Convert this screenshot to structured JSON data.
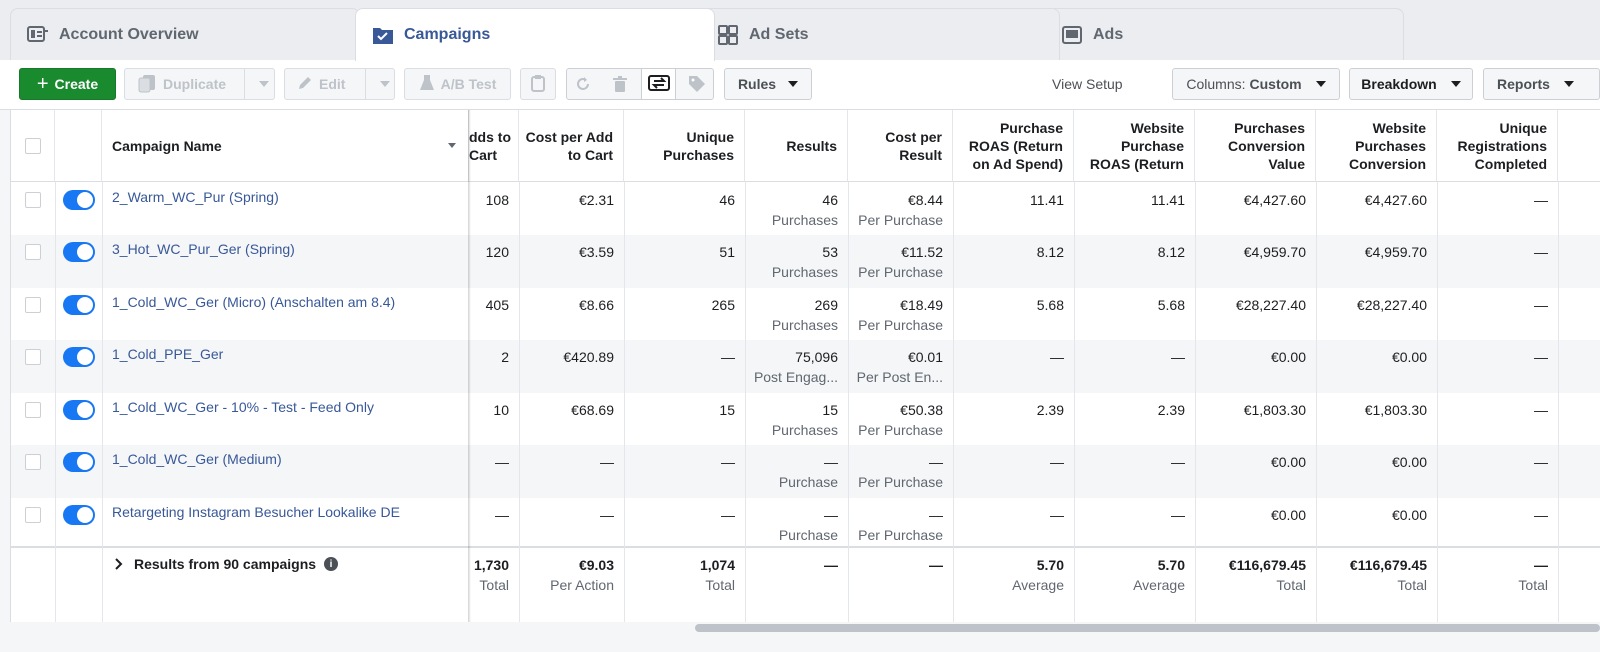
{
  "tabs": [
    {
      "label": "Account Overview",
      "icon": "account-overview-icon"
    },
    {
      "label": "Campaigns",
      "icon": "campaigns-folder-icon"
    },
    {
      "label": "Ad Sets",
      "icon": "ad-sets-grid-icon"
    },
    {
      "label": "Ads",
      "icon": "ads-icon"
    }
  ],
  "toolbar": {
    "create": "Create",
    "duplicate": "Duplicate",
    "edit": "Edit",
    "ab_test": "A/B Test",
    "rules": "Rules",
    "view_setup": "View Setup",
    "columns_prefix": "Columns:",
    "columns_value": "Custom",
    "breakdown": "Breakdown",
    "reports": "Reports"
  },
  "colors": {
    "accent": "#1877f2",
    "create_green": "#1a8a2e",
    "link": "#385898"
  },
  "table": {
    "headers": {
      "campaign_name": "Campaign Name",
      "adds_to_cart": "dds to Cart",
      "cost_per_add": "Cost per Add to Cart",
      "unique_purchases": "Unique Purchases",
      "results": "Results",
      "cost_per_result": "Cost per Result",
      "purchase_roas": "Purchase ROAS (Return on Ad Spend)",
      "website_roas": "Website Purchase ROAS (Return",
      "conv_value": "Purchases Conversion Value",
      "website_conv": "Website Purchases Conversion",
      "unique_reg": "Unique Registrations Completed"
    },
    "rows": [
      {
        "name": "2_Warm_WC_Pur (Spring)",
        "adds": "108",
        "cpa": "€2.31",
        "uniq": "46",
        "res": "46",
        "res_sub": "Purchases",
        "cpr": "€8.44",
        "cpr_sub": "Per Purchase",
        "roas": "11.41",
        "wroas": "11.41",
        "cv": "€4,427.60",
        "wcv": "€4,427.60",
        "ureg": "—"
      },
      {
        "name": "3_Hot_WC_Pur_Ger (Spring)",
        "adds": "120",
        "cpa": "€3.59",
        "uniq": "51",
        "res": "53",
        "res_sub": "Purchases",
        "cpr": "€11.52",
        "cpr_sub": "Per Purchase",
        "roas": "8.12",
        "wroas": "8.12",
        "cv": "€4,959.70",
        "wcv": "€4,959.70",
        "ureg": "—"
      },
      {
        "name": "1_Cold_WC_Ger (Micro) (Anschalten am 8.4)",
        "adds": "405",
        "cpa": "€8.66",
        "uniq": "265",
        "res": "269",
        "res_sub": "Purchases",
        "cpr": "€18.49",
        "cpr_sub": "Per Purchase",
        "roas": "5.68",
        "wroas": "5.68",
        "cv": "€28,227.40",
        "wcv": "€28,227.40",
        "ureg": "—"
      },
      {
        "name": "1_Cold_PPE_Ger",
        "adds": "2",
        "cpa": "€420.89",
        "uniq": "—",
        "res": "75,096",
        "res_sub": "Post Engag...",
        "cpr": "€0.01",
        "cpr_sub": "Per Post En...",
        "roas": "—",
        "wroas": "—",
        "cv": "€0.00",
        "wcv": "€0.00",
        "ureg": "—"
      },
      {
        "name": "1_Cold_WC_Ger - 10% - Test - Feed Only",
        "adds": "10",
        "cpa": "€68.69",
        "uniq": "15",
        "res": "15",
        "res_sub": "Purchases",
        "cpr": "€50.38",
        "cpr_sub": "Per Purchase",
        "roas": "2.39",
        "wroas": "2.39",
        "cv": "€1,803.30",
        "wcv": "€1,803.30",
        "ureg": "—"
      },
      {
        "name": "1_Cold_WC_Ger (Medium)",
        "adds": "—",
        "cpa": "—",
        "uniq": "—",
        "res": "—",
        "res_sub": "Purchase",
        "cpr": "—",
        "cpr_sub": "Per Purchase",
        "roas": "—",
        "wroas": "—",
        "cv": "€0.00",
        "wcv": "€0.00",
        "ureg": "—"
      },
      {
        "name": "Retargeting Instagram Besucher Lookalike DE",
        "adds": "—",
        "cpa": "—",
        "uniq": "—",
        "res": "—",
        "res_sub": "Purchase",
        "cpr": "—",
        "cpr_sub": "Per Purchase",
        "roas": "—",
        "wroas": "—",
        "cv": "€0.00",
        "wcv": "€0.00",
        "ureg": "—"
      }
    ],
    "totals": {
      "label": "Results from 90 campaigns",
      "adds": "1,730",
      "adds_sub": "Total",
      "cpa": "€9.03",
      "cpa_sub": "Per Action",
      "uniq": "1,074",
      "uniq_sub": "Total",
      "res": "—",
      "cpr": "—",
      "roas": "5.70",
      "roas_sub": "Average",
      "wroas": "5.70",
      "wroas_sub": "Average",
      "cv": "€116,679.45",
      "cv_sub": "Total",
      "wcv": "€116,679.45",
      "wcv_sub": "Total",
      "ureg": "—",
      "ureg_sub": "Total"
    }
  }
}
